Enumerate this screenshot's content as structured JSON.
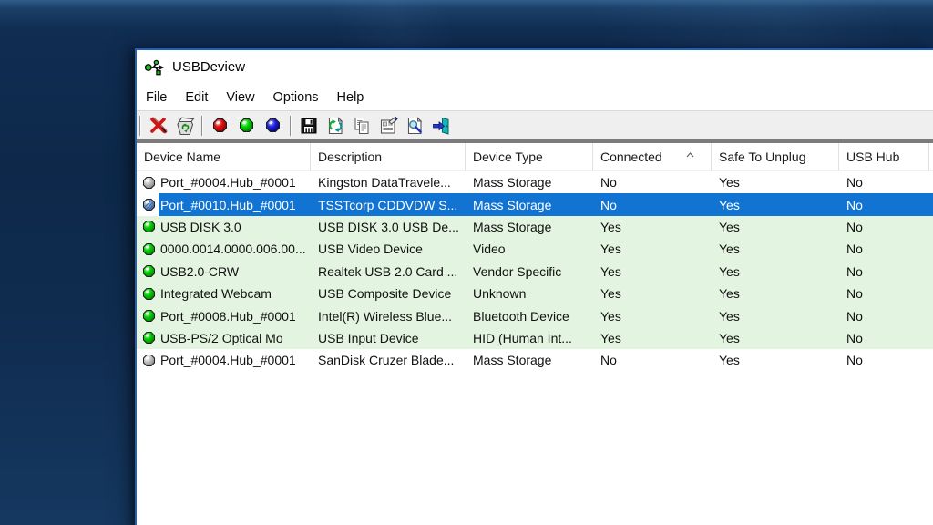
{
  "window": {
    "title": "USBDeview",
    "app_icon": "usb-trident-icon"
  },
  "menu": {
    "items": [
      {
        "label": "File"
      },
      {
        "label": "Edit"
      },
      {
        "label": "View"
      },
      {
        "label": "Options"
      },
      {
        "label": "Help"
      }
    ]
  },
  "toolbar": {
    "buttons": [
      {
        "icon": "uninstall-device-icon"
      },
      {
        "icon": "recycle-bin-icon"
      },
      {
        "icon": "red-ball-icon"
      },
      {
        "icon": "green-ball-icon"
      },
      {
        "icon": "blue-ball-icon"
      },
      {
        "icon": "save-icon"
      },
      {
        "icon": "refresh-icon"
      },
      {
        "icon": "copy-icon"
      },
      {
        "icon": "properties-icon"
      },
      {
        "icon": "find-icon"
      },
      {
        "icon": "exit-icon"
      }
    ]
  },
  "table": {
    "columns": [
      {
        "label": "Device Name"
      },
      {
        "label": "Description"
      },
      {
        "label": "Device Type"
      },
      {
        "label": "Connected",
        "sorted": "asc"
      },
      {
        "label": "Safe To Unplug"
      },
      {
        "label": "USB Hub"
      }
    ],
    "rows": [
      {
        "state": "disconnected",
        "ball": "gray",
        "name": "Port_#0004.Hub_#0001",
        "description": "Kingston DataTravele...",
        "type": "Mass Storage",
        "connected": "No",
        "safe_to_unplug": "Yes",
        "usb_hub": "No"
      },
      {
        "state": "selected",
        "ball": "steel",
        "name": "Port_#0010.Hub_#0001",
        "description": "TSSTcorp CDDVDW S...",
        "type": "Mass Storage",
        "connected": "No",
        "safe_to_unplug": "Yes",
        "usb_hub": "No"
      },
      {
        "state": "connected",
        "ball": "green",
        "name": "USB DISK 3.0",
        "description": "USB DISK 3.0 USB De...",
        "type": "Mass Storage",
        "connected": "Yes",
        "safe_to_unplug": "Yes",
        "usb_hub": "No"
      },
      {
        "state": "connected",
        "ball": "green",
        "name": "0000.0014.0000.006.00...",
        "description": "USB Video Device",
        "type": "Video",
        "connected": "Yes",
        "safe_to_unplug": "Yes",
        "usb_hub": "No"
      },
      {
        "state": "connected",
        "ball": "green",
        "name": "USB2.0-CRW",
        "description": "Realtek USB 2.0 Card ...",
        "type": "Vendor Specific",
        "connected": "Yes",
        "safe_to_unplug": "Yes",
        "usb_hub": "No"
      },
      {
        "state": "connected",
        "ball": "green",
        "name": "Integrated Webcam",
        "description": "USB Composite Device",
        "type": "Unknown",
        "connected": "Yes",
        "safe_to_unplug": "Yes",
        "usb_hub": "No"
      },
      {
        "state": "connected",
        "ball": "green",
        "name": "Port_#0008.Hub_#0001",
        "description": "Intel(R) Wireless Blue...",
        "type": "Bluetooth Device",
        "connected": "Yes",
        "safe_to_unplug": "Yes",
        "usb_hub": "No"
      },
      {
        "state": "connected",
        "ball": "green",
        "name": "USB-PS/2 Optical Mo",
        "description": "USB Input Device",
        "type": "HID (Human Int...",
        "connected": "Yes",
        "safe_to_unplug": "Yes",
        "usb_hub": "No"
      },
      {
        "state": "disconnected",
        "ball": "gray",
        "name": "Port_#0004.Hub_#0001",
        "description": "SanDisk Cruzer Blade...",
        "type": "Mass Storage",
        "connected": "No",
        "safe_to_unplug": "Yes",
        "usb_hub": "No"
      }
    ]
  },
  "colors": {
    "selection_blue": "#1174d2",
    "connected_row_green": "#e3f5e0",
    "toolbar_gray": "#efefef",
    "desktop_navy": "#0d2849",
    "window_border_blue": "#1c60bf",
    "ball_green": "#00d200",
    "ball_gray": "#c0c0c0",
    "ball_red": "#e01010",
    "ball_blue": "#2121dd"
  }
}
